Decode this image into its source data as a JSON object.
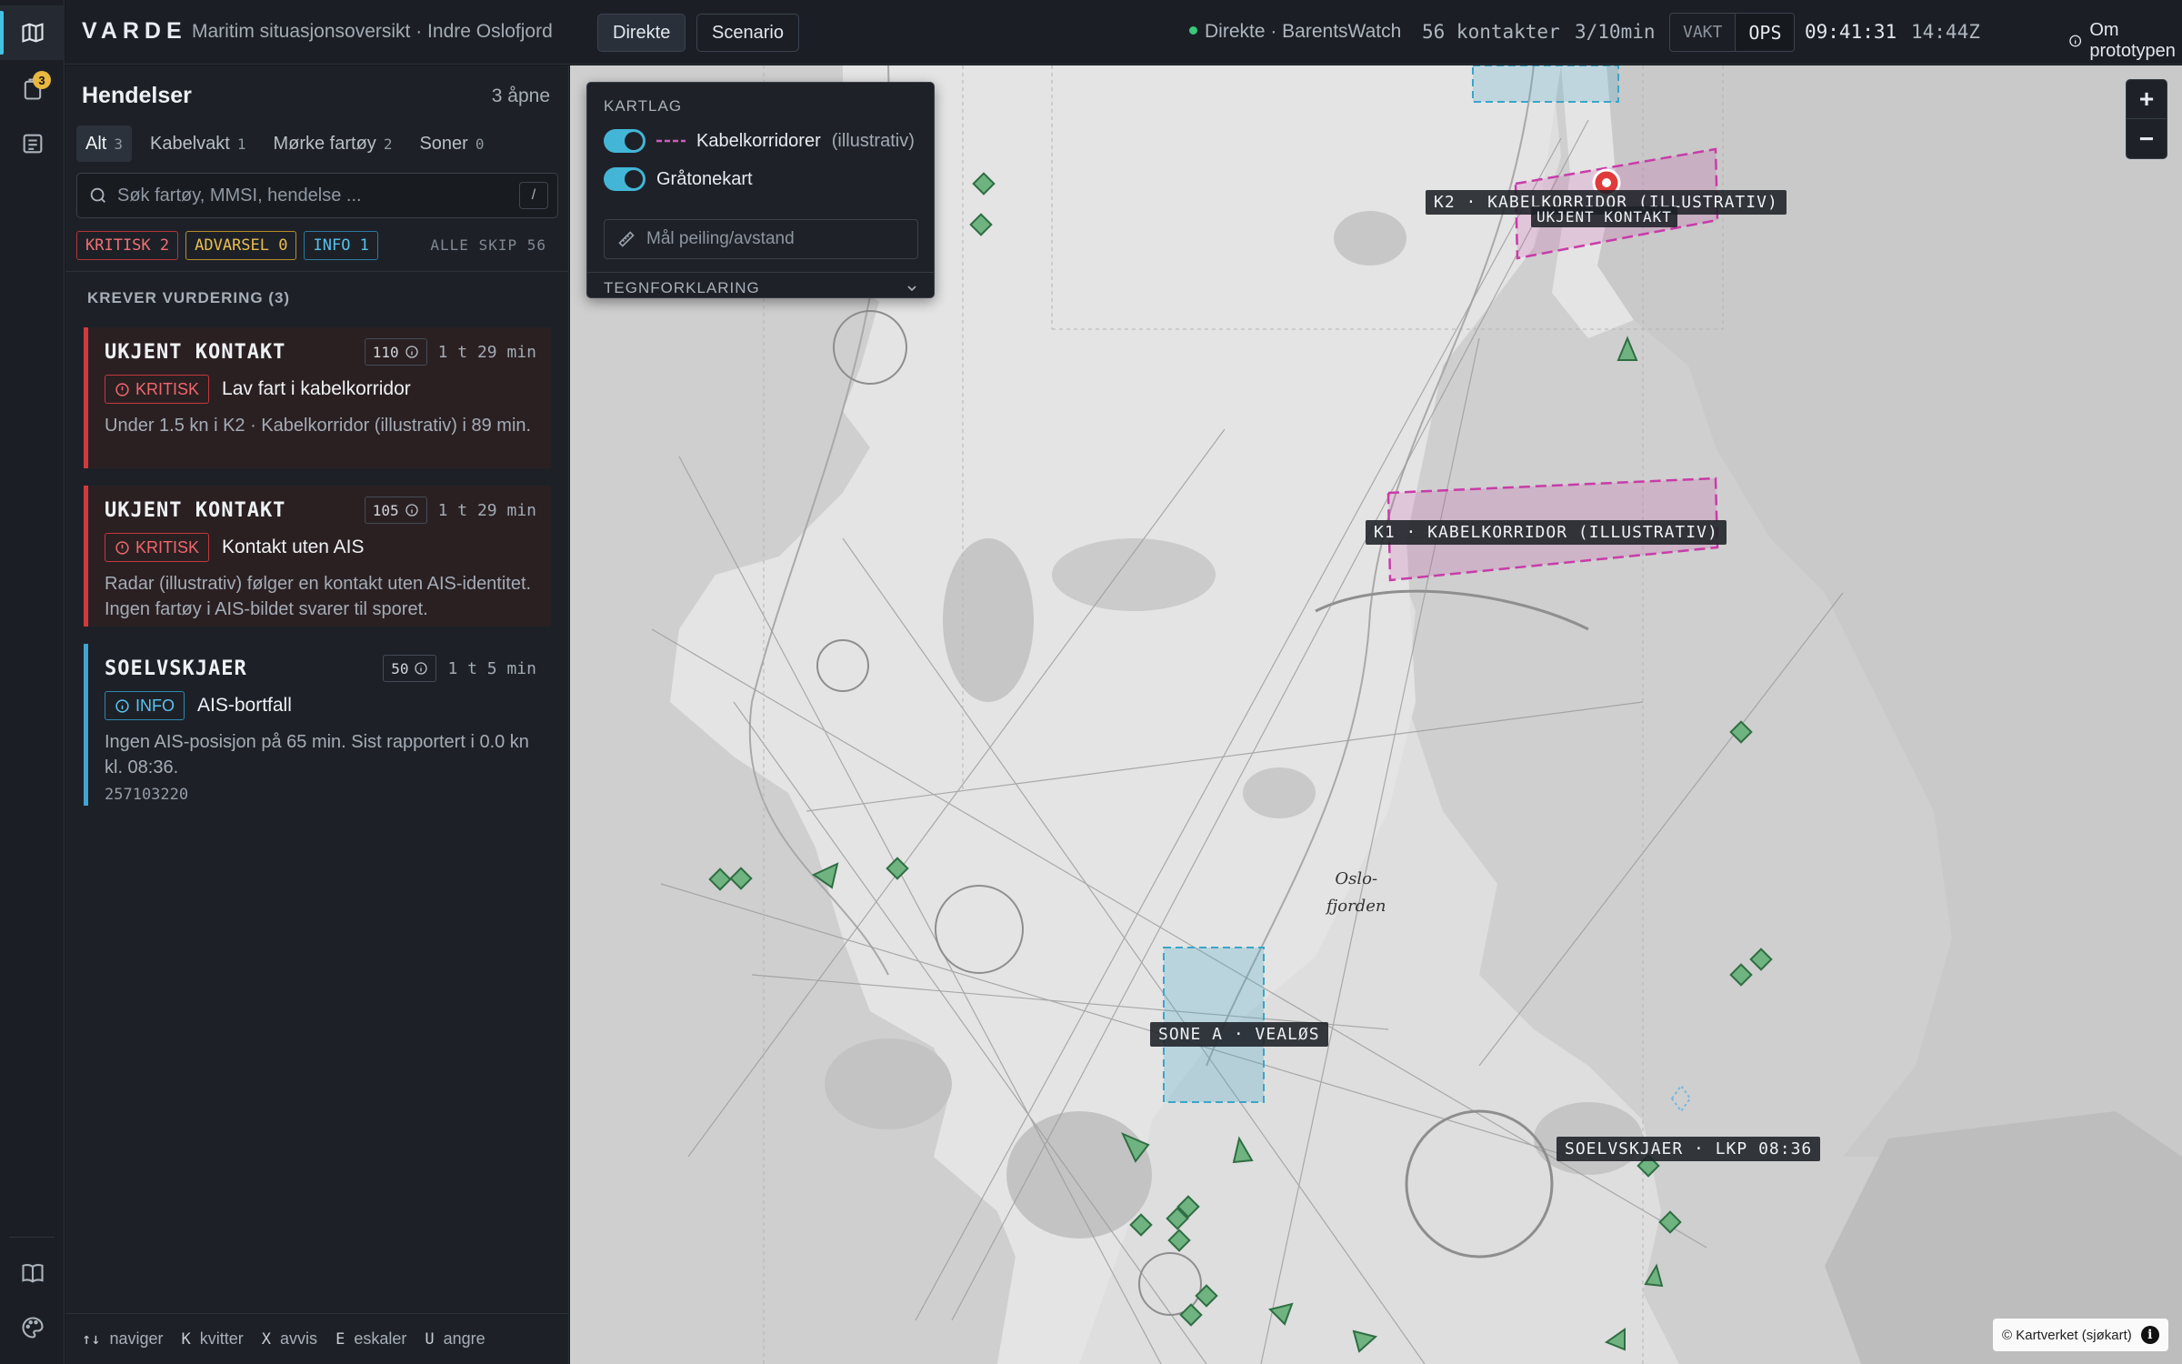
{
  "header": {
    "brand": "VARDE",
    "subtitle": "Maritim situasjonsoversikt · Indre Oslofjord",
    "modes": [
      "Direkte",
      "Scenario"
    ],
    "source": "Direkte · BarentsWatch",
    "contacts": "56 kontakter",
    "rate": "3/10min",
    "role_off": "VAKT",
    "role_on": "OPS",
    "time": "09:41:31",
    "zulu": "14:44Z",
    "about": "Om prototypen"
  },
  "rail": {
    "badge": "3"
  },
  "sidebar": {
    "title": "Hendelser",
    "open_count": "3 åpne",
    "tabs": [
      {
        "label": "Alt",
        "count": "3"
      },
      {
        "label": "Kabelvakt",
        "count": "1"
      },
      {
        "label": "Mørke fartøy",
        "count": "2"
      },
      {
        "label": "Soner",
        "count": "0"
      }
    ],
    "search_placeholder": "Søk fartøy, MMSI, hendelse ...",
    "search_key": "/",
    "chips": {
      "critical": "KRITISK 2",
      "warning": "ADVARSEL 0",
      "info": "INFO 1"
    },
    "all_ships": "ALLE SKIP 56",
    "section": "KREVER VURDERING (3)",
    "cards": [
      {
        "name": "UKJENT KONTAKT",
        "score": "110",
        "age": "1 t 29 min",
        "severity": "KRITISK",
        "title": "Lav fart i kabelkorridor",
        "desc": "Under 1.5 kn i K2 · Kabelkorridor (illustrativ) i 89 min.",
        "mmsi": ""
      },
      {
        "name": "UKJENT KONTAKT",
        "score": "105",
        "age": "1 t 29 min",
        "severity": "KRITISK",
        "title": "Kontakt uten AIS",
        "desc": "Radar (illustrativ) følger en kontakt uten AIS-identitet. Ingen fartøy i AIS-bildet svarer til sporet.",
        "mmsi": ""
      },
      {
        "name": "SOELVSKJAER",
        "score": "50",
        "age": "1 t 5 min",
        "severity": "INFO",
        "title": "AIS-bortfall",
        "desc": "Ingen AIS-posisjon på 65 min. Sist rapportert i 0.0 kn kl. 08:36.",
        "mmsi": "257103220"
      }
    ],
    "shortcuts": [
      {
        "key": "↑↓",
        "label": "naviger"
      },
      {
        "key": "K",
        "label": "kvitter"
      },
      {
        "key": "X",
        "label": "avvis"
      },
      {
        "key": "E",
        "label": "eskaler"
      },
      {
        "key": "U",
        "label": "angre"
      }
    ]
  },
  "layers": {
    "heading": "KARTLAG",
    "cable": "Kabelkorridorer",
    "cable_note": "(illustrativ)",
    "grey": "Gråtonekart",
    "measure_placeholder": "Mål peiling/avstand",
    "legend": "TEGNFORKLARING"
  },
  "map": {
    "label_k2": "K2 · KABELKORRIDOR (ILLUSTRATIV)",
    "label_unknown": "UKJENT KONTAKT",
    "label_k1": "K1 · KABELKORRIDOR (ILLUSTRATIV)",
    "label_zone": "SONE A · VEALØS",
    "label_soelv": "SOELVSKJAER · LKP 08:36",
    "place_oslofjorden": "Oslo-\nfjorden",
    "attribution": "© Kartverket (sjøkart)",
    "colors": {
      "critical": "#e03a3a",
      "cable": "#c83ca8",
      "zone": "#3aa5c8",
      "vessel": "#4c9a62"
    }
  }
}
